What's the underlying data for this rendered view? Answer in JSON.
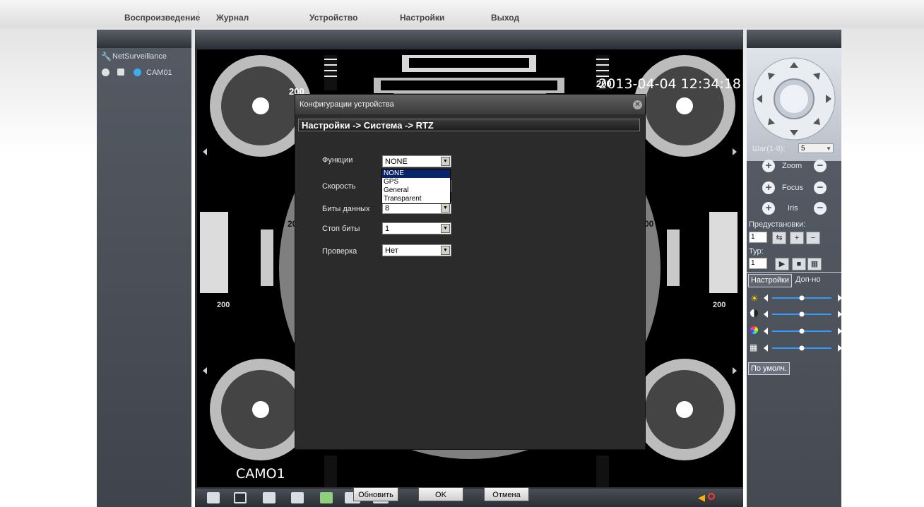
{
  "menu": {
    "items": [
      "Воспроизведение",
      "Журнал",
      "Устройство",
      "Настройки",
      "Выход"
    ]
  },
  "tree": {
    "root_label": "NetSurveillance",
    "camera_label": "CAM01"
  },
  "video": {
    "timestamp": "2013-04-04 12:34:18",
    "camera_overlay": "CAMO1",
    "chart_marks": [
      "200",
      "200",
      "200",
      "200",
      "20",
      "00"
    ]
  },
  "dialog": {
    "title": "Конфигурации устройства",
    "breadcrumb": "Настройки -> Система -> RTZ",
    "fields": [
      {
        "label": "Функции",
        "value": "NONE"
      },
      {
        "label": "Скорость",
        "value": ""
      },
      {
        "label": "Биты данных",
        "value": "8"
      },
      {
        "label": "Стоп биты",
        "value": "1"
      },
      {
        "label": "Проверка",
        "value": "Нет"
      }
    ],
    "dropdown_options": [
      "NONE",
      "GPS",
      "General",
      "Transparent"
    ],
    "dropdown_selected": "NONE",
    "buttons": {
      "refresh": "Обновить",
      "ok": "OK",
      "cancel": "Отмена"
    }
  },
  "ptz": {
    "step_label": "Шаг(1-8):",
    "step_value": "5",
    "zoom_label": "Zoom",
    "focus_label": "Focus",
    "iris_label": "Iris",
    "presets_label": "Предустановки:",
    "preset_value": "1",
    "tour_label": "Тур:",
    "tour_value": "1"
  },
  "image_tabs": {
    "settings": "Настройки",
    "extra": "Доп-но"
  },
  "image_sliders": [
    {
      "icon": "brightness-icon",
      "level": 0.5
    },
    {
      "icon": "contrast-icon",
      "level": 0.5
    },
    {
      "icon": "saturation-icon",
      "level": 0.5
    },
    {
      "icon": "hue-icon",
      "level": 0.5
    }
  ],
  "default_button": "По умолч.",
  "colors": {
    "accent_blue": "#3399ff",
    "dropdown_highlight": "#0a246a",
    "mute_red": "#ff3b30"
  }
}
